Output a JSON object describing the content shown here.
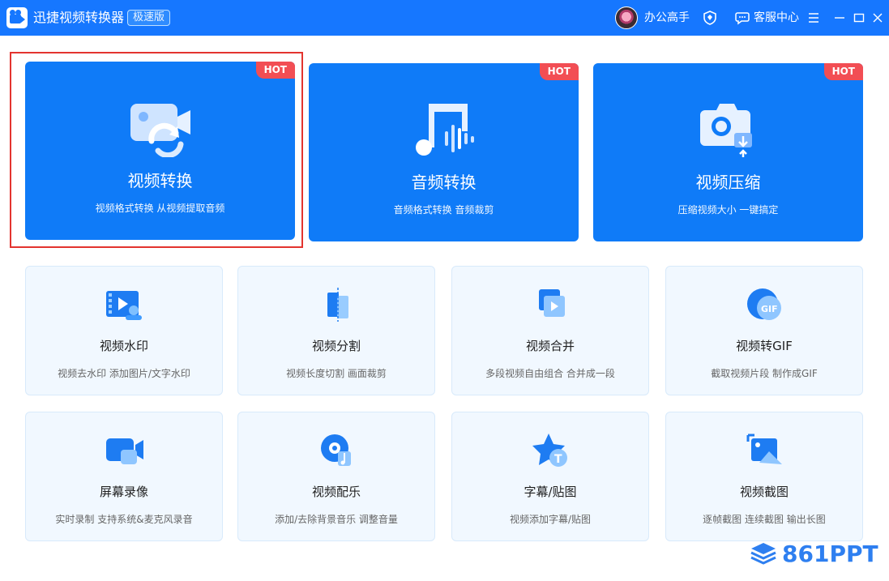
{
  "app": {
    "title": "迅捷视频转换器",
    "edition": "极速版"
  },
  "user": {
    "name": "办公高手"
  },
  "titlebar": {
    "service_label": "客服中心"
  },
  "feature_cards": [
    {
      "title": "视频转换",
      "subtitle": "视频格式转换 从视频提取音频",
      "badge": "HOT",
      "icon": "video-convert-icon"
    },
    {
      "title": "音频转换",
      "subtitle": "音频格式转换 音频裁剪",
      "badge": "HOT",
      "icon": "audio-convert-icon"
    },
    {
      "title": "视频压缩",
      "subtitle": "压缩视频大小 一键搞定",
      "badge": "HOT",
      "icon": "video-compress-icon"
    }
  ],
  "tools": [
    {
      "title": "视频水印",
      "subtitle": "视频去水印 添加图片/文字水印",
      "icon": "watermark-icon"
    },
    {
      "title": "视频分割",
      "subtitle": "视频长度切割 画面裁剪",
      "icon": "split-icon"
    },
    {
      "title": "视频合并",
      "subtitle": "多段视频自由组合 合并成一段",
      "icon": "merge-icon"
    },
    {
      "title": "视频转GIF",
      "subtitle": "截取视频片段 制作成GIF",
      "icon": "gif-icon",
      "icon_text": "GIF"
    },
    {
      "title": "屏幕录像",
      "subtitle": "实时录制 支持系统&麦克风录音",
      "icon": "screen-record-icon"
    },
    {
      "title": "视频配乐",
      "subtitle": "添加/去除背景音乐 调整音量",
      "icon": "music-icon"
    },
    {
      "title": "字幕/贴图",
      "subtitle": "视频添加字幕/贴图",
      "icon": "subtitle-sticker-icon",
      "icon_text": "T"
    },
    {
      "title": "视频截图",
      "subtitle": "逐帧截图 连续截图 输出长图",
      "icon": "screenshot-icon"
    }
  ],
  "watermark": {
    "text": "861PPT"
  },
  "colors": {
    "titlebar": "#1677ff",
    "card_blue": "#0f7bf8",
    "hot_badge": "#f24e54",
    "tool_card_bg": "#f1f8ff",
    "highlight_border": "#e3342f"
  }
}
